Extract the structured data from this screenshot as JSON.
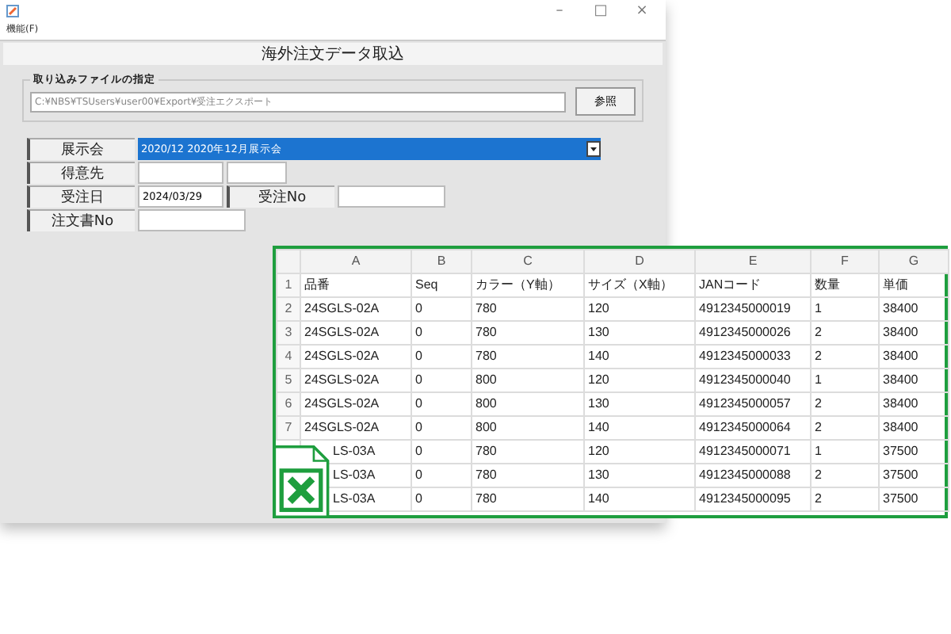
{
  "window": {
    "controls": [
      "–",
      "□",
      "×"
    ],
    "menu": [
      "機能(F)"
    ],
    "header": "海外注文データ取込"
  },
  "file_group": {
    "legend": "取り込みファイルの指定",
    "path": "C:¥NBS¥TSUsers¥user00¥Export¥受注エクスポート",
    "browse_button": "参照"
  },
  "form_rows": [
    [
      {
        "kind": "label",
        "text": "展示会"
      },
      {
        "kind": "select",
        "value": "2020/12 2020年12月展示会"
      }
    ],
    [
      {
        "kind": "label",
        "text": "得意先"
      },
      {
        "kind": "field"
      },
      {
        "kind": "narrow_field"
      }
    ],
    [
      {
        "kind": "label",
        "text": "受注日"
      },
      {
        "kind": "field",
        "value": "2024/03/29"
      },
      {
        "kind": "label",
        "text": "受注No"
      },
      {
        "kind": "wide_field"
      }
    ],
    [
      {
        "kind": "label",
        "text": "注文書No"
      },
      {
        "kind": "wide_field"
      }
    ]
  ],
  "sheet": {
    "columns": [
      "A",
      "B",
      "C",
      "D",
      "E",
      "F",
      "G"
    ],
    "rows": [
      {
        "number": "1",
        "cells": [
          "品番",
          "Seq",
          "カラー（Y軸）",
          "サイズ（X軸）",
          "JANコード",
          "数量",
          "単価"
        ]
      },
      {
        "number": "2",
        "cells": [
          "24SGLS-02A",
          "0",
          "780",
          "120",
          "4912345000019",
          "1",
          "38400"
        ]
      },
      {
        "number": "3",
        "cells": [
          "24SGLS-02A",
          "0",
          "780",
          "130",
          "4912345000026",
          "2",
          "38400"
        ]
      },
      {
        "number": "4",
        "cells": [
          "24SGLS-02A",
          "0",
          "780",
          "140",
          "4912345000033",
          "2",
          "38400"
        ]
      },
      {
        "number": "5",
        "cells": [
          "24SGLS-02A",
          "0",
          "800",
          "120",
          "4912345000040",
          "1",
          "38400"
        ]
      },
      {
        "number": "6",
        "cells": [
          "24SGLS-02A",
          "0",
          "800",
          "130",
          "4912345000057",
          "2",
          "38400"
        ]
      },
      {
        "number": "7",
        "cells": [
          "24SGLS-02A",
          "0",
          "800",
          "140",
          "4912345000064",
          "2",
          "38400"
        ]
      },
      {
        "cells": [
          "LS-03A",
          "0",
          "780",
          "120",
          "4912345000071",
          "1",
          "37500"
        ]
      },
      {
        "cells": [
          "LS-03A",
          "0",
          "780",
          "130",
          "4912345000088",
          "2",
          "37500"
        ]
      },
      {
        "cells": [
          "LS-03A",
          "0",
          "780",
          "140",
          "4912345000095",
          "2",
          "37500"
        ]
      }
    ]
  }
}
